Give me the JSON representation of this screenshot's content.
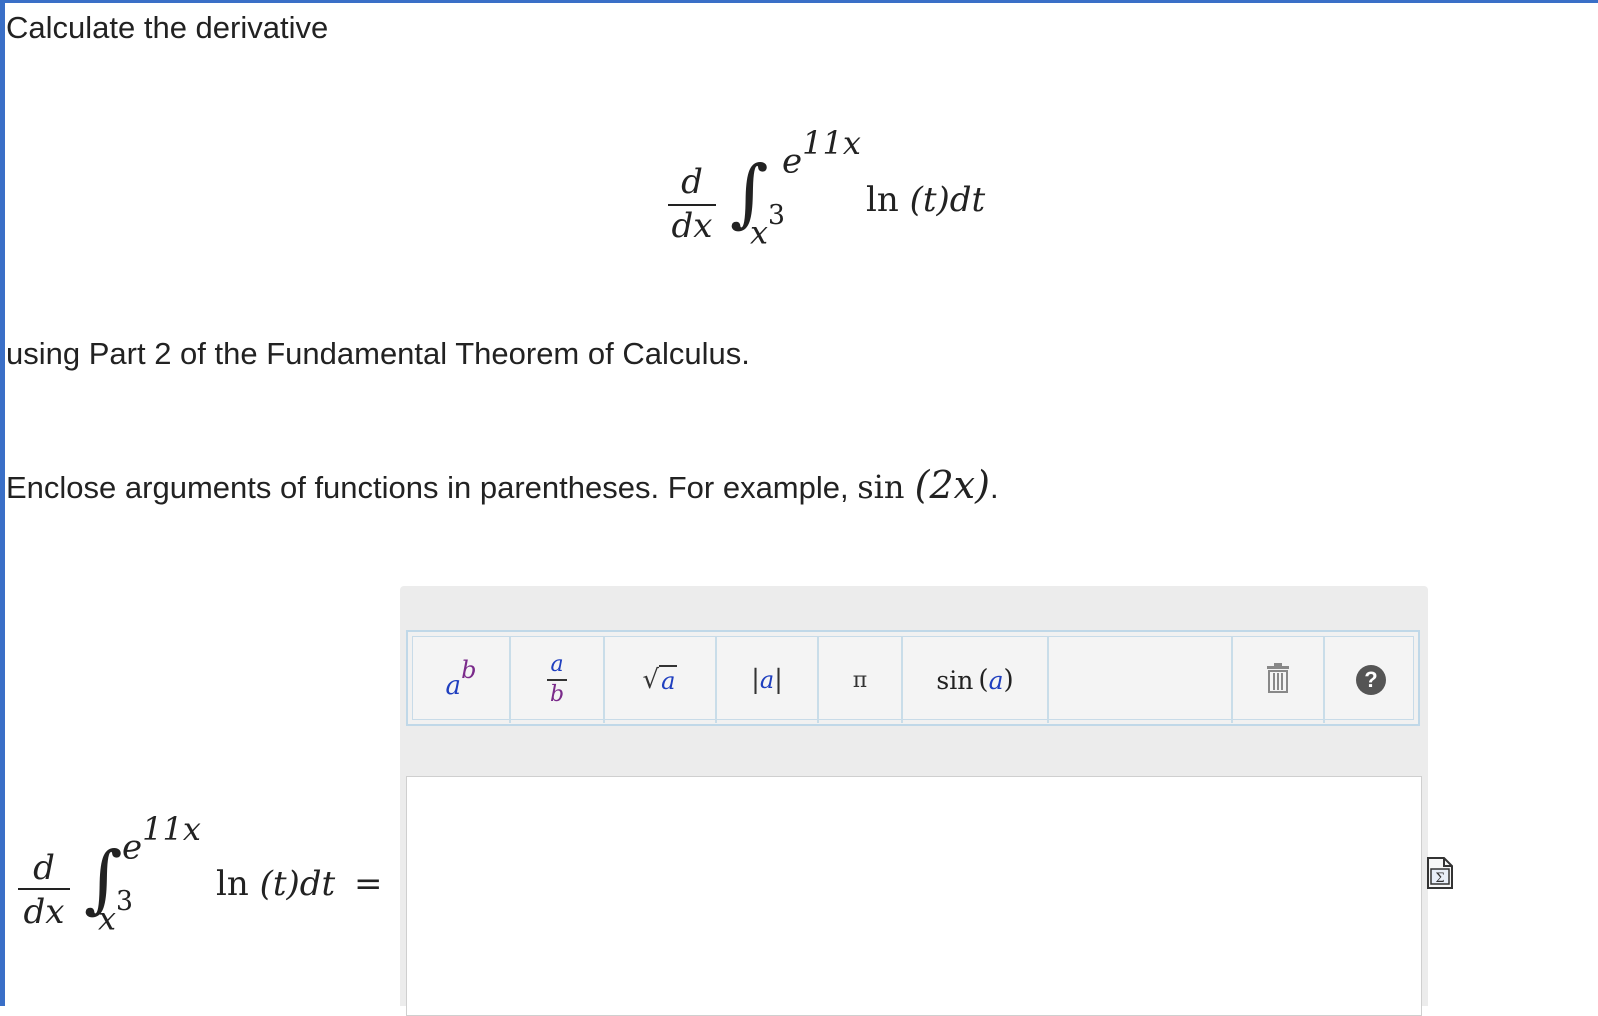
{
  "prompt": {
    "intro": "Calculate the derivative",
    "method": "using Part 2 of the Fundamental Theorem of Calculus.",
    "hint_prefix": "Enclose arguments of functions in parentheses. For example, ",
    "hint_example": "sin (2x).",
    "hint_example_func": "sin",
    "hint_example_arg": "(2x)",
    "hint_example_tail": "."
  },
  "expression": {
    "d_numerator": "d",
    "d_denominator": "dx",
    "upper_limit_base": "e",
    "upper_limit_exp": "11x",
    "lower_limit_base": "x",
    "lower_limit_exp": "3",
    "integrand_func": "ln",
    "integrand_arg": "(t)",
    "differential": "dt",
    "equals": "="
  },
  "toolbar": {
    "power": {
      "base": "a",
      "exp": "b"
    },
    "fraction": {
      "num": "a",
      "den": "b"
    },
    "sqrt": {
      "sym": "√",
      "arg": "a"
    },
    "abs": {
      "bar": "|",
      "arg": "a"
    },
    "pi": "π",
    "sin": {
      "func": "sin",
      "lparen": "(",
      "arg": "a",
      "rparen": ")"
    },
    "help": "?"
  },
  "answer": {
    "value": ""
  },
  "icons": {
    "trash": "trash-icon",
    "help": "help-icon",
    "formula": "formula-sigma-icon"
  },
  "colors": {
    "frame_border": "#3a6fc7",
    "symbol_blue": "#1f3fbf",
    "symbol_purple": "#7a2a8a"
  }
}
